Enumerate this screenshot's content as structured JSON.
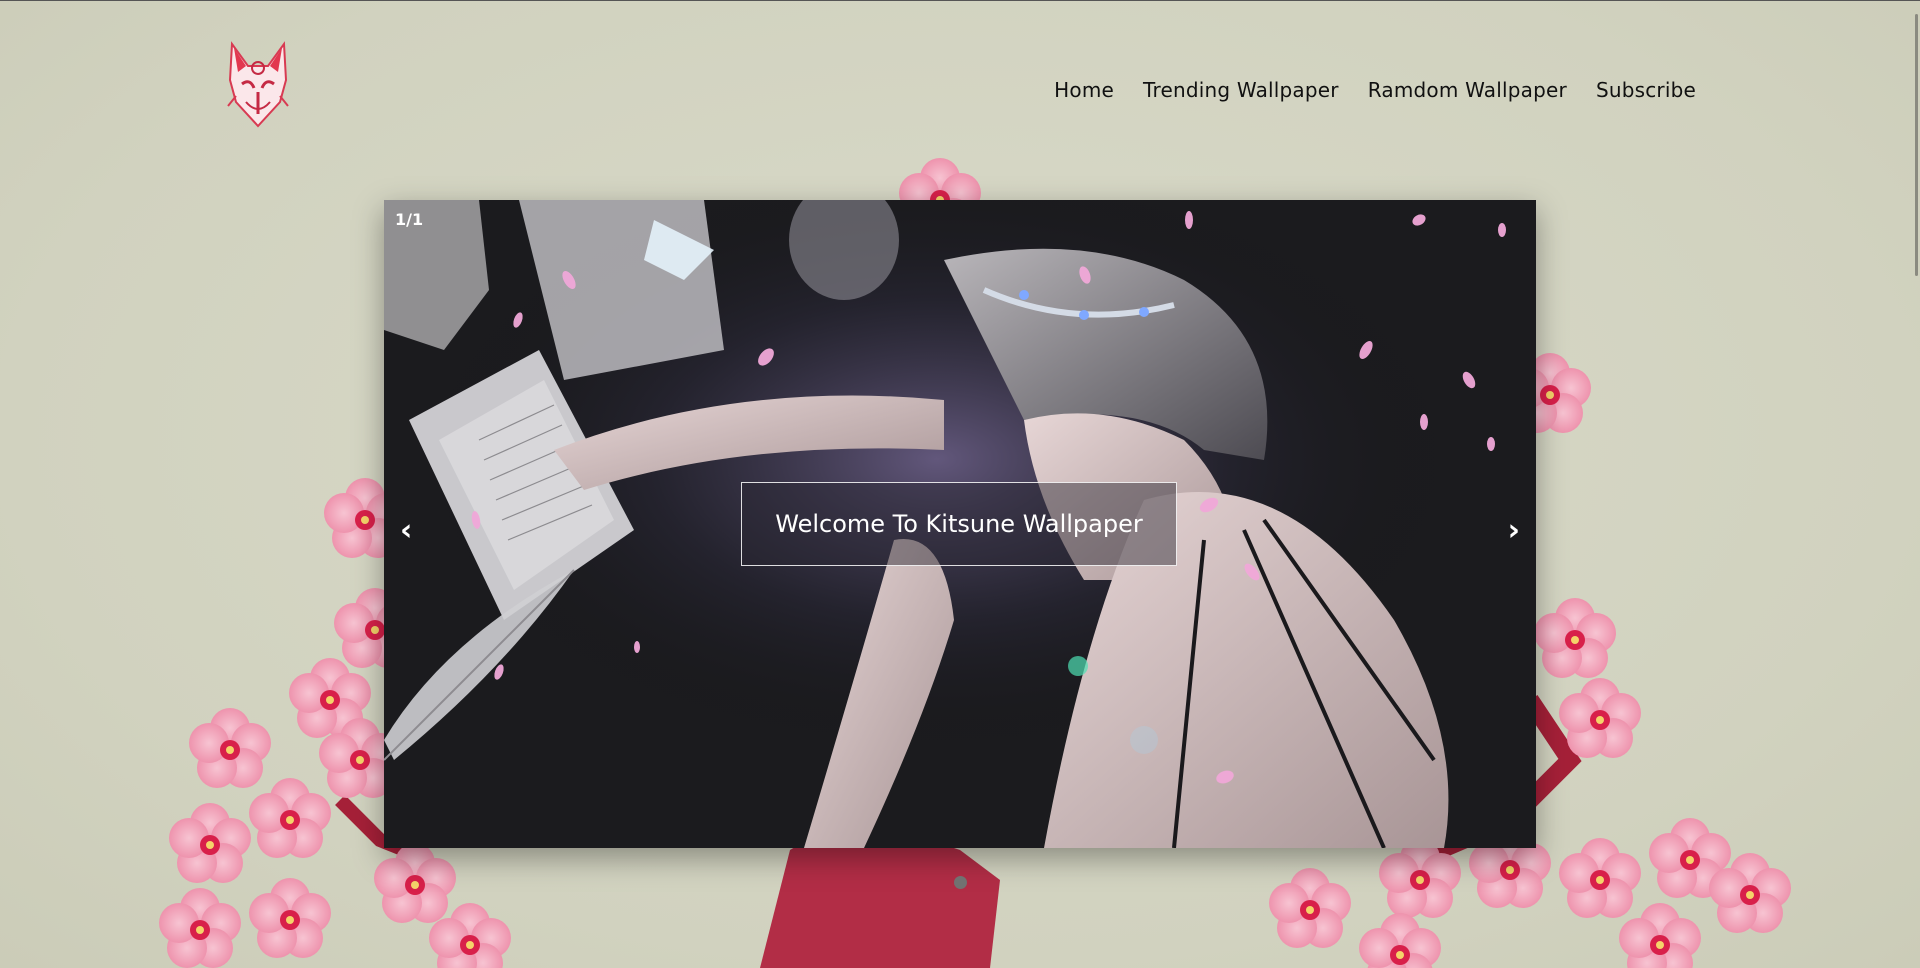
{
  "brand": {
    "logo_icon": "kitsune-mask-icon"
  },
  "nav": {
    "items": [
      {
        "label": "Home"
      },
      {
        "label": "Trending Wallpaper"
      },
      {
        "label": "Ramdom Wallpaper"
      },
      {
        "label": "Subscribe"
      }
    ]
  },
  "slider": {
    "counter": "1/1",
    "caption": "Welcome To Kitsune Wallpaper",
    "prev_icon": "‹",
    "next_icon": "›",
    "active_slide": 1,
    "total_slides": 1
  },
  "colors": {
    "background": "#d3d4c2",
    "blossom": "#f2a6bd",
    "blossom_center": "#d8204a",
    "branch": "#b0243f"
  }
}
